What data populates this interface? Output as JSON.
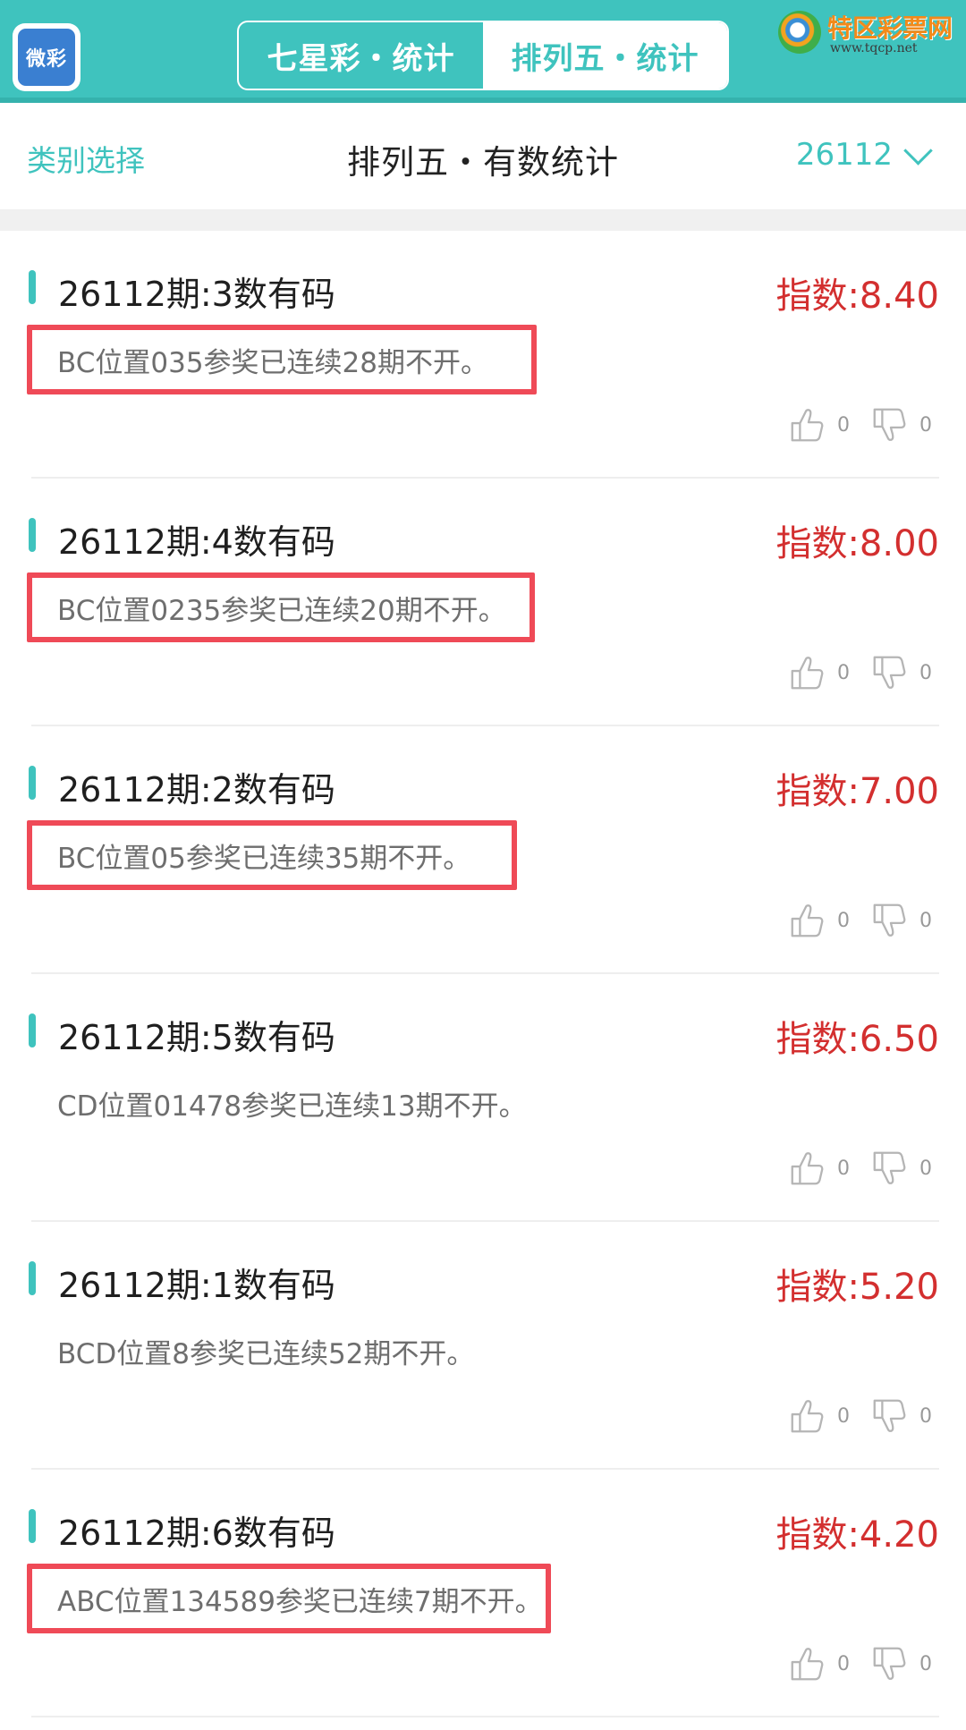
{
  "header": {
    "app_logo_text": "微彩",
    "tabs": [
      {
        "label": "七星彩・统计",
        "active": false
      },
      {
        "label": "排列五・统计",
        "active": true
      }
    ],
    "watermark": {
      "title": "特区彩票网",
      "url": "www.tqcp.net"
    }
  },
  "subheader": {
    "category_link": "类别选择",
    "page_title": "排列五・有数统计",
    "period": "26112"
  },
  "colors": {
    "accent": "#3fc3be",
    "index_red": "#d32f2f",
    "highlight_box": "#ef4a57"
  },
  "cards": [
    {
      "title": "26112期:3数有码",
      "index": "指数:8.40",
      "desc": "BC位置035参奖已连续28期不开。",
      "highlighted": true,
      "likes": "0",
      "dislikes": "0"
    },
    {
      "title": "26112期:4数有码",
      "index": "指数:8.00",
      "desc": "BC位置0235参奖已连续20期不开。",
      "highlighted": true,
      "likes": "0",
      "dislikes": "0"
    },
    {
      "title": "26112期:2数有码",
      "index": "指数:7.00",
      "desc": "BC位置05参奖已连续35期不开。",
      "highlighted": true,
      "likes": "0",
      "dislikes": "0"
    },
    {
      "title": "26112期:5数有码",
      "index": "指数:6.50",
      "desc": "CD位置01478参奖已连续13期不开。",
      "highlighted": false,
      "likes": "0",
      "dislikes": "0"
    },
    {
      "title": "26112期:1数有码",
      "index": "指数:5.20",
      "desc": "BCD位置8参奖已连续52期不开。",
      "highlighted": false,
      "likes": "0",
      "dislikes": "0"
    },
    {
      "title": "26112期:6数有码",
      "index": "指数:4.20",
      "desc": "ABC位置134589参奖已连续7期不开。",
      "highlighted": true,
      "likes": "0",
      "dislikes": "0"
    }
  ]
}
